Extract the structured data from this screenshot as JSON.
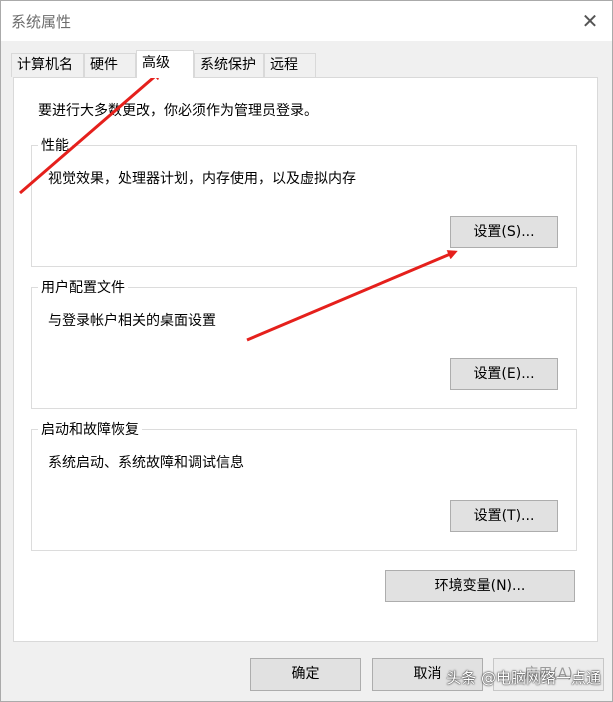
{
  "window": {
    "title": "系统属性",
    "close_glyph": "✕"
  },
  "tabs": [
    {
      "label": "计算机名"
    },
    {
      "label": "硬件"
    },
    {
      "label": "高级",
      "active": true
    },
    {
      "label": "系统保护"
    },
    {
      "label": "远程"
    }
  ],
  "admin_note": "要进行大多数更改，你必须作为管理员登录。",
  "groups": {
    "performance": {
      "label": "性能",
      "description": "视觉效果，处理器计划，内存使用，以及虚拟内存",
      "button": "设置(S)..."
    },
    "user_profiles": {
      "label": "用户配置文件",
      "description": "与登录帐户相关的桌面设置",
      "button": "设置(E)..."
    },
    "startup_recovery": {
      "label": "启动和故障恢复",
      "description": "系统启动、系统故障和调试信息",
      "button": "设置(T)..."
    }
  },
  "env_button": "环境变量(N)...",
  "footer": {
    "ok": "确定",
    "cancel": "取消",
    "apply": "应用(A)"
  },
  "watermark": "头条 @电脑网络一点通",
  "colors": {
    "arrow": "#e5201c"
  }
}
